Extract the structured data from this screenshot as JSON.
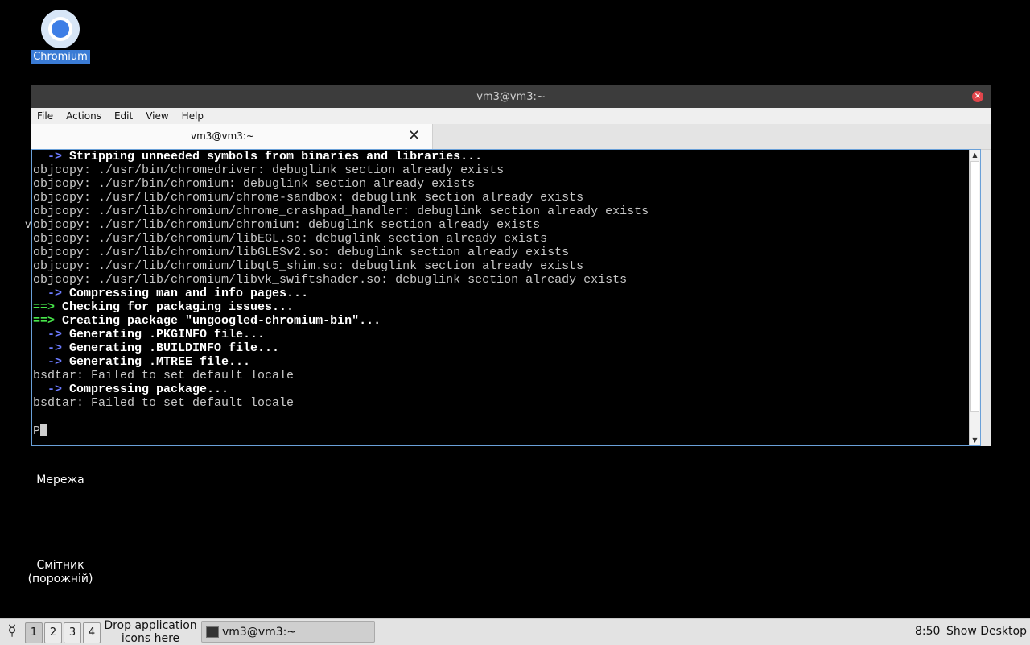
{
  "desktop": {
    "icons": [
      {
        "label": "Chromium"
      },
      {
        "label": "Мережа"
      },
      {
        "label_line1": "Смітник",
        "label_line2": "(порожній)"
      }
    ],
    "fragment": "v"
  },
  "window": {
    "title": "vm3@vm3:~",
    "menu": [
      "File",
      "Actions",
      "Edit",
      "View",
      "Help"
    ],
    "tab_title": "vm3@vm3:~",
    "terminal_lines": [
      {
        "prefix": "  -> ",
        "style": "blue",
        "text": "Stripping unneeded symbols from binaries and libraries..."
      },
      {
        "text": "objcopy: ./usr/bin/chromedriver: debuglink section already exists"
      },
      {
        "text": "objcopy: ./usr/bin/chromium: debuglink section already exists"
      },
      {
        "text": "objcopy: ./usr/lib/chromium/chrome-sandbox: debuglink section already exists"
      },
      {
        "text": "objcopy: ./usr/lib/chromium/chrome_crashpad_handler: debuglink section already exists"
      },
      {
        "text": "objcopy: ./usr/lib/chromium/chromium: debuglink section already exists"
      },
      {
        "text": "objcopy: ./usr/lib/chromium/libEGL.so: debuglink section already exists"
      },
      {
        "text": "objcopy: ./usr/lib/chromium/libGLESv2.so: debuglink section already exists"
      },
      {
        "text": "objcopy: ./usr/lib/chromium/libqt5_shim.so: debuglink section already exists"
      },
      {
        "text": "objcopy: ./usr/lib/chromium/libvk_swiftshader.so: debuglink section already exists"
      },
      {
        "prefix": "  -> ",
        "style": "blue",
        "text": "Compressing man and info pages..."
      },
      {
        "prefix": "==> ",
        "style": "green",
        "text": "Checking for packaging issues..."
      },
      {
        "prefix": "==> ",
        "style": "green",
        "text": "Creating package \"ungoogled-chromium-bin\"..."
      },
      {
        "prefix": "  -> ",
        "style": "blue",
        "text": "Generating .PKGINFO file..."
      },
      {
        "prefix": "  -> ",
        "style": "blue",
        "text": "Generating .BUILDINFO file..."
      },
      {
        "prefix": "  -> ",
        "style": "blue",
        "text": "Generating .MTREE file..."
      },
      {
        "text": "bsdtar: Failed to set default locale"
      },
      {
        "prefix": "  -> ",
        "style": "blue",
        "text": "Compressing package..."
      },
      {
        "text": "bsdtar: Failed to set default locale"
      },
      {
        "text": ""
      }
    ],
    "prompt": "P"
  },
  "taskbar": {
    "workspaces": [
      "1",
      "2",
      "3",
      "4"
    ],
    "drop_line1": "Drop application",
    "drop_line2": "icons here",
    "task_label": "vm3@vm3:~",
    "clock": "8:50",
    "show_desktop": "Show Desktop"
  }
}
